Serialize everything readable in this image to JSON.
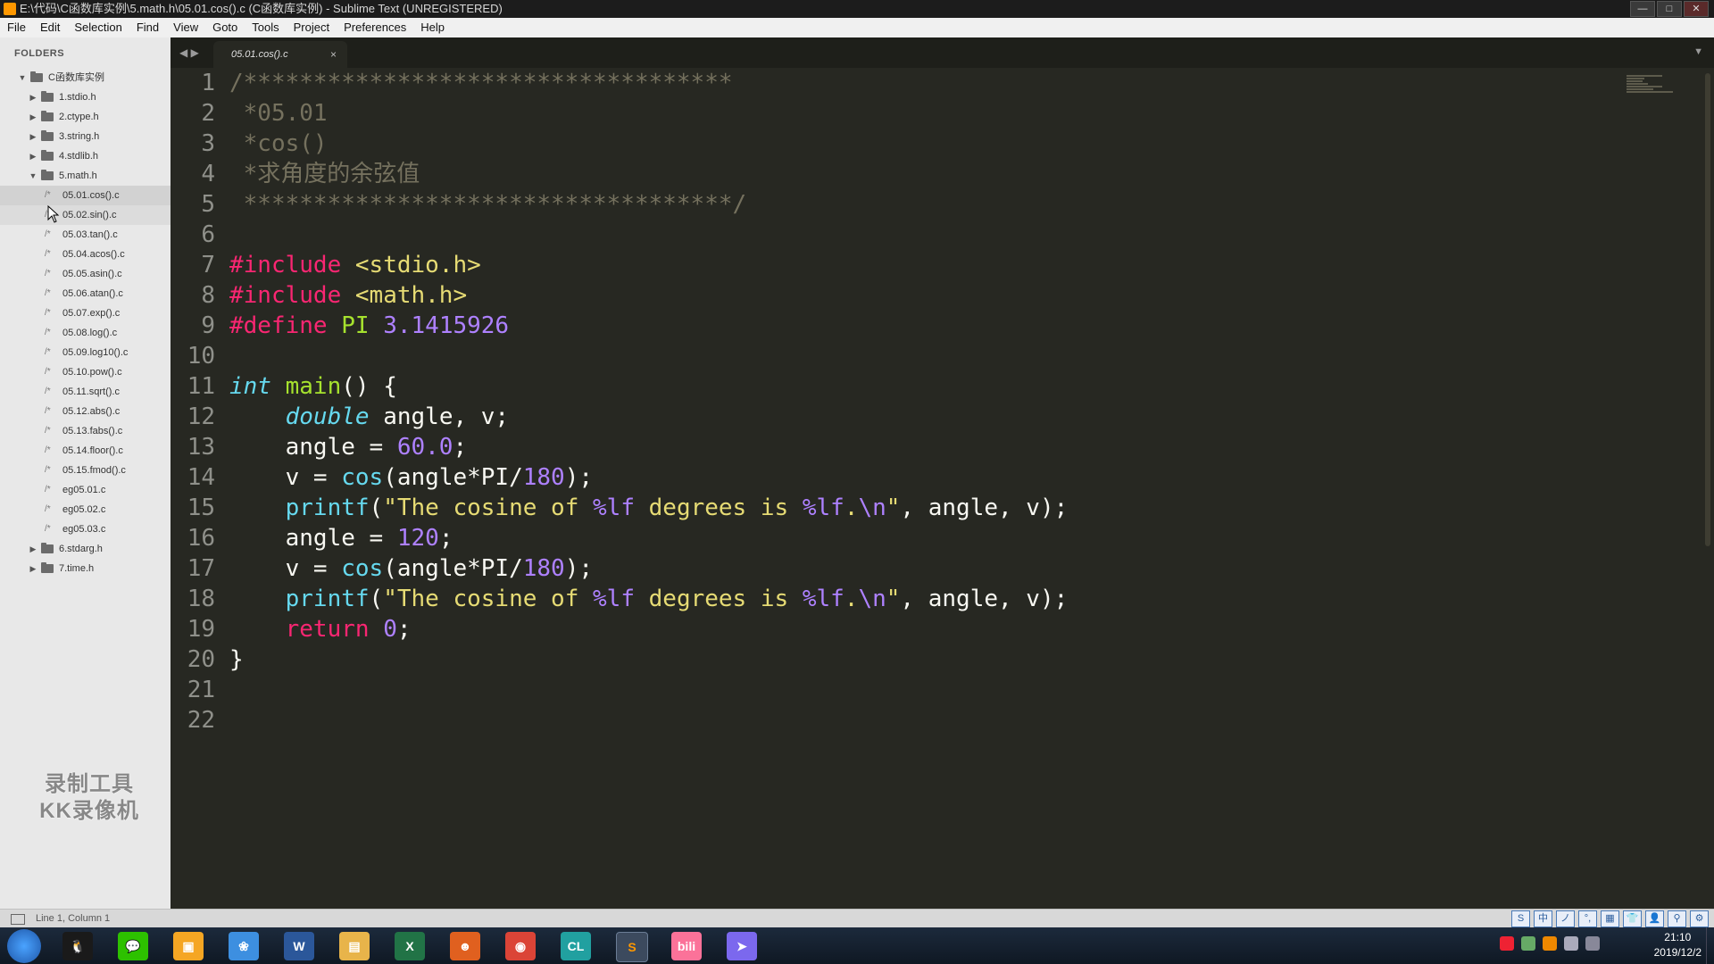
{
  "window": {
    "title": "E:\\代码\\C函数库实例\\5.math.h\\05.01.cos().c (C函数库实例) - Sublime Text (UNREGISTERED)",
    "controls": [
      "—",
      "□",
      "✕"
    ]
  },
  "menu": [
    "File",
    "Edit",
    "Selection",
    "Find",
    "View",
    "Goto",
    "Tools",
    "Project",
    "Preferences",
    "Help"
  ],
  "sidebar": {
    "header": "FOLDERS",
    "items": [
      {
        "label": "C函数库实例",
        "kind": "folder",
        "depth": 0,
        "open": true
      },
      {
        "label": "1.stdio.h",
        "kind": "folder",
        "depth": 1,
        "open": false
      },
      {
        "label": "2.ctype.h",
        "kind": "folder",
        "depth": 1,
        "open": false
      },
      {
        "label": "3.string.h",
        "kind": "folder",
        "depth": 1,
        "open": false
      },
      {
        "label": "4.stdlib.h",
        "kind": "folder",
        "depth": 1,
        "open": false
      },
      {
        "label": "5.math.h",
        "kind": "folder",
        "depth": 1,
        "open": true
      },
      {
        "label": "05.01.cos().c",
        "kind": "file",
        "depth": 2,
        "selected": true
      },
      {
        "label": "05.02.sin().c",
        "kind": "file",
        "depth": 2,
        "hover": true
      },
      {
        "label": "05.03.tan().c",
        "kind": "file",
        "depth": 2
      },
      {
        "label": "05.04.acos().c",
        "kind": "file",
        "depth": 2
      },
      {
        "label": "05.05.asin().c",
        "kind": "file",
        "depth": 2
      },
      {
        "label": "05.06.atan().c",
        "kind": "file",
        "depth": 2
      },
      {
        "label": "05.07.exp().c",
        "kind": "file",
        "depth": 2
      },
      {
        "label": "05.08.log().c",
        "kind": "file",
        "depth": 2
      },
      {
        "label": "05.09.log10().c",
        "kind": "file",
        "depth": 2
      },
      {
        "label": "05.10.pow().c",
        "kind": "file",
        "depth": 2
      },
      {
        "label": "05.11.sqrt().c",
        "kind": "file",
        "depth": 2
      },
      {
        "label": "05.12.abs().c",
        "kind": "file",
        "depth": 2
      },
      {
        "label": "05.13.fabs().c",
        "kind": "file",
        "depth": 2
      },
      {
        "label": "05.14.floor().c",
        "kind": "file",
        "depth": 2
      },
      {
        "label": "05.15.fmod().c",
        "kind": "file",
        "depth": 2
      },
      {
        "label": "eg05.01.c",
        "kind": "file",
        "depth": 2
      },
      {
        "label": "eg05.02.c",
        "kind": "file",
        "depth": 2
      },
      {
        "label": "eg05.03.c",
        "kind": "file",
        "depth": 2
      },
      {
        "label": "6.stdarg.h",
        "kind": "folder",
        "depth": 1,
        "open": false
      },
      {
        "label": "7.time.h",
        "kind": "folder",
        "depth": 1,
        "open": false
      }
    ]
  },
  "watermark": {
    "line1": "录制工具",
    "line2": "KK录像机"
  },
  "tabs": {
    "nav": "◀ ▶",
    "active": "05.01.cos().c",
    "close": "×",
    "dropdown": "▼"
  },
  "editor": {
    "lines": [
      [
        [
          "c",
          "/***********************************"
        ]
      ],
      [
        [
          "c",
          " *05.01"
        ]
      ],
      [
        [
          "c",
          " *cos()"
        ]
      ],
      [
        [
          "c",
          " *求角度的余弦值"
        ]
      ],
      [
        [
          "c",
          " ***********************************/"
        ]
      ],
      [],
      [
        [
          "p",
          "#include"
        ],
        [
          "t",
          " "
        ],
        [
          "s",
          "<stdio.h>"
        ]
      ],
      [
        [
          "p",
          "#include"
        ],
        [
          "t",
          " "
        ],
        [
          "s",
          "<math.h>"
        ]
      ],
      [
        [
          "p",
          "#define"
        ],
        [
          "t",
          " "
        ],
        [
          "f",
          "PI"
        ],
        [
          "t",
          " "
        ],
        [
          "n",
          "3.1415926"
        ]
      ],
      [],
      [
        [
          "y",
          "int"
        ],
        [
          "t",
          " "
        ],
        [
          "f",
          "main"
        ],
        [
          "t",
          "() {"
        ]
      ],
      [
        [
          "t",
          "    "
        ],
        [
          "y",
          "double"
        ],
        [
          "t",
          " angle, v;"
        ]
      ],
      [
        [
          "t",
          "    angle = "
        ],
        [
          "n",
          "60.0"
        ],
        [
          "t",
          ";"
        ]
      ],
      [
        [
          "t",
          "    v = "
        ],
        [
          "u",
          "cos"
        ],
        [
          "t",
          "(angle*PI/"
        ],
        [
          "n",
          "180"
        ],
        [
          "t",
          ");"
        ]
      ],
      [
        [
          "t",
          "    "
        ],
        [
          "u",
          "printf"
        ],
        [
          "t",
          "("
        ],
        [
          "s",
          "\"The cosine of "
        ],
        [
          "n",
          "%lf"
        ],
        [
          "s",
          " degrees is "
        ],
        [
          "n",
          "%lf"
        ],
        [
          "s",
          "."
        ],
        [
          "n",
          "\\n"
        ],
        [
          "s",
          "\""
        ],
        [
          "t",
          ", angle, v);"
        ]
      ],
      [
        [
          "t",
          "    angle = "
        ],
        [
          "n",
          "120"
        ],
        [
          "t",
          ";"
        ]
      ],
      [
        [
          "t",
          "    v = "
        ],
        [
          "u",
          "cos"
        ],
        [
          "t",
          "(angle*PI/"
        ],
        [
          "n",
          "180"
        ],
        [
          "t",
          ");"
        ]
      ],
      [
        [
          "t",
          "    "
        ],
        [
          "u",
          "printf"
        ],
        [
          "t",
          "("
        ],
        [
          "s",
          "\"The cosine of "
        ],
        [
          "n",
          "%lf"
        ],
        [
          "s",
          " degrees is "
        ],
        [
          "n",
          "%lf"
        ],
        [
          "s",
          "."
        ],
        [
          "n",
          "\\n"
        ],
        [
          "s",
          "\""
        ],
        [
          "t",
          ", angle, v);"
        ]
      ],
      [
        [
          "t",
          "    "
        ],
        [
          "k",
          "return"
        ],
        [
          "t",
          " "
        ],
        [
          "n",
          "0"
        ],
        [
          "t",
          ";"
        ]
      ],
      [
        [
          "t",
          "}"
        ]
      ],
      [],
      []
    ]
  },
  "status": {
    "text": "Line 1, Column 1"
  },
  "ime_icons": [
    "S",
    "中",
    "ノ",
    "°,",
    "▦",
    "👕",
    "👤",
    "⚲",
    "⚙"
  ],
  "taskbar": {
    "apps": [
      {
        "name": "qq-icon",
        "glyph": "🐧",
        "color": "#1a1a1a"
      },
      {
        "name": "wechat-icon",
        "glyph": "💬",
        "color": "#2dc100"
      },
      {
        "name": "folder-app-icon",
        "glyph": "▣",
        "color": "#f5a623"
      },
      {
        "name": "photos-icon",
        "glyph": "❀",
        "color": "#3d8fe0"
      },
      {
        "name": "word-icon",
        "glyph": "W",
        "color": "#2b579a"
      },
      {
        "name": "explorer-icon",
        "glyph": "▤",
        "color": "#e8b44a"
      },
      {
        "name": "excel-icon",
        "glyph": "X",
        "color": "#217346"
      },
      {
        "name": "game-icon",
        "glyph": "☻",
        "color": "#e0601f"
      },
      {
        "name": "chrome-icon",
        "glyph": "◉",
        "color": "#db4437"
      },
      {
        "name": "clion-icon",
        "glyph": "CL",
        "color": "#21a0a0"
      },
      {
        "name": "sublime-icon",
        "glyph": "S",
        "color": "#ff9800",
        "active": true
      },
      {
        "name": "bilibili-icon",
        "glyph": "bili",
        "color": "#fb7299"
      },
      {
        "name": "kite-icon",
        "glyph": "➤",
        "color": "#7b68ee"
      }
    ],
    "clock_time": "21:10",
    "clock_date": "2019/12/2"
  },
  "colors": {
    "bg": "#272822",
    "comment": "#75715e",
    "string": "#e6db74",
    "number": "#ae81ff",
    "keyword": "#f92672",
    "type": "#66d9ef",
    "function": "#a6e22e"
  }
}
